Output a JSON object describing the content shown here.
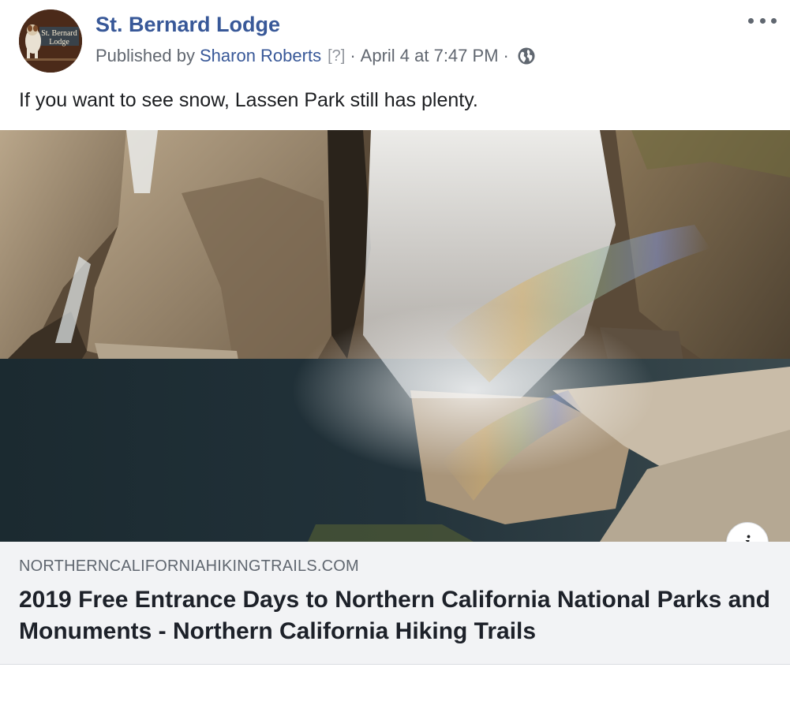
{
  "post": {
    "page_name": "St. Bernard Lodge",
    "avatar_text": "St. Bernard Lodge",
    "published_by_prefix": "Published by",
    "author": "Sharon Roberts",
    "author_help": "[?]",
    "separator": "·",
    "timestamp": "April 4 at 7:47 PM",
    "audience_icon": "globe-icon",
    "more_icon": "more-options-icon",
    "text": "If you want to see snow, Lassen Park still has plenty."
  },
  "link_preview": {
    "image": "waterfall-photo",
    "info_icon": "i",
    "domain": "NORTHERNCALIFORNIAHIKINGTRAILS.COM",
    "title": "2019 Free Entrance Days to Northern California National Parks and Monuments - Northern California Hiking Trails"
  },
  "colors": {
    "link_blue": "#385898",
    "meta_gray": "#616770",
    "link_box_bg": "#f2f3f5"
  }
}
